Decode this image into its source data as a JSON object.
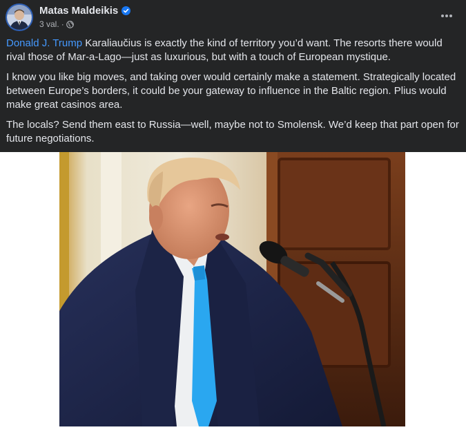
{
  "post": {
    "author": "Matas Maldeikis",
    "time": "3 val.",
    "separator": "·",
    "mention": "Donald J. Trump",
    "paragraph1_rest": " Karaliaučius is exactly the kind of territory you’d want. The resorts there would rival those of Mar-a-Lago—just as luxurious, but with a touch of European mystique.",
    "paragraph2": "I know you like big moves, and taking over would certainly make a statement. Strategically located between Europe’s borders, it could be your gateway to influence in the Baltic region. Plius would make great casinos area.",
    "paragraph3": "The locals? Send them east to Russia—well, maybe not to Smolensk. We’d keep that part open for future negotiations.",
    "more_label": "···"
  },
  "icons": {
    "verified": "verified-badge-icon",
    "audience": "globe-icon",
    "more": "more-options-icon"
  },
  "colors": {
    "card_background": "#242526",
    "text": "#e4e6eb",
    "secondary_text": "#b0b3b8",
    "link": "#4599ff",
    "verified": "#1877f2",
    "tie": "#2aa7f0",
    "suit": "#1c2446"
  }
}
